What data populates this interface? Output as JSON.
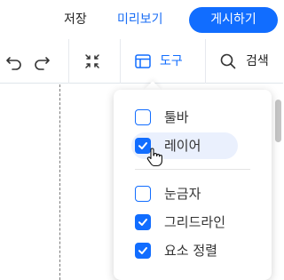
{
  "header": {
    "save_label": "저장",
    "preview_label": "미리보기",
    "publish_label": "게시하기"
  },
  "toolbar": {
    "undo_icon": "undo-icon",
    "redo_icon": "redo-icon",
    "zoom_fit_icon": "zoom-to-fit-icon",
    "tools_label": "도구",
    "search_label": "검색"
  },
  "tools_menu": {
    "items": [
      {
        "label": "툴바",
        "checked": false
      },
      {
        "label": "레이어",
        "checked": true
      },
      {
        "label": "눈금자",
        "checked": false
      },
      {
        "label": "그리드라인",
        "checked": true
      },
      {
        "label": "요소 정렬",
        "checked": true
      }
    ]
  },
  "colors": {
    "accent": "#116dff",
    "text": "#333333",
    "hover_bg": "#eaf0fd"
  }
}
